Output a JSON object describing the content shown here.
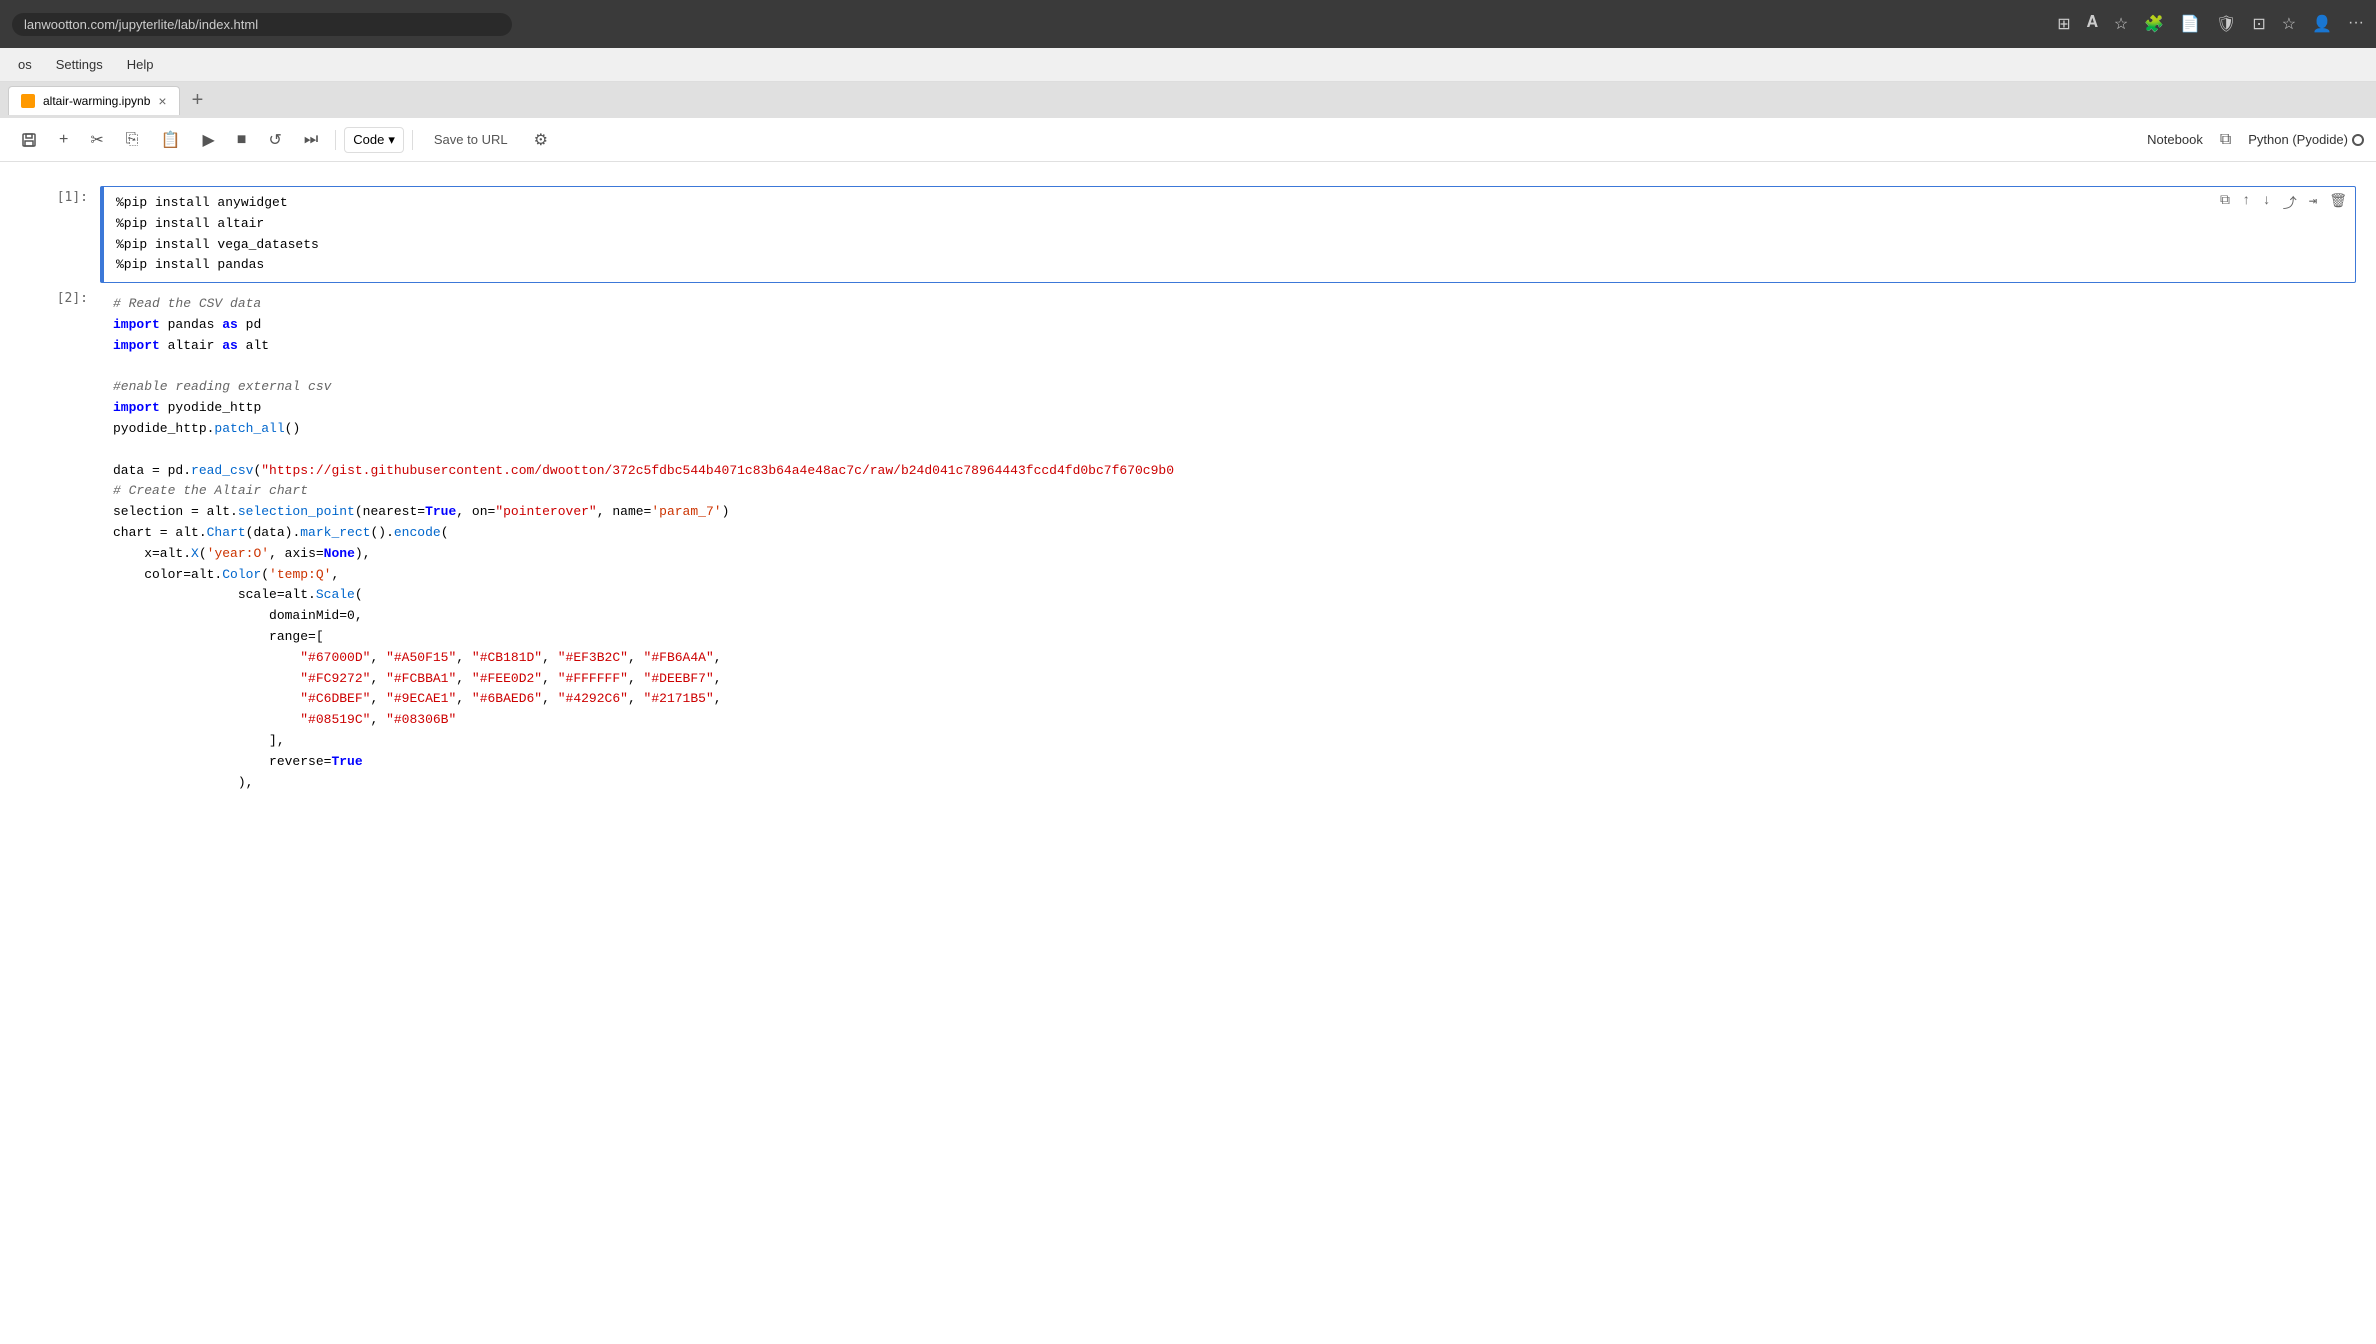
{
  "browser": {
    "url": "lanwootton.com/jupyterlite/lab/index.html"
  },
  "menu": {
    "items": [
      "os",
      "Settings",
      "Help"
    ]
  },
  "tab": {
    "icon_color": "#f90",
    "label": "altair-warming.ipynb",
    "close_symbol": "×"
  },
  "toolbar": {
    "save_icon": "💾",
    "add_icon": "+",
    "cut_icon": "✂",
    "copy_icon": "⎘",
    "paste_icon": "📋",
    "run_icon": "▶",
    "stop_icon": "■",
    "restart_icon": "↺",
    "fast_forward_icon": "⏭",
    "kernel_label": "Code",
    "save_url_label": "Save to URL",
    "settings_icon": "⚙",
    "notebook_label": "Notebook",
    "open_icon": "⧉",
    "kernel_name": "Python (Pyodide)"
  },
  "cell1": {
    "number": "[1]:",
    "lines": [
      "%pip install anywidget",
      "%pip install altair",
      "%pip install vega_datasets",
      "%pip install pandas"
    ]
  },
  "cell2": {
    "number": "[2]:",
    "lines": [
      "# Read the CSV data",
      "import pandas as pd",
      "import altair as alt",
      "",
      "#enable reading external csv",
      "import pyodide_http",
      "pyodide_http.patch_all()",
      "",
      "data = pd.read_csv(\"https://gist.githubusercontent.com/dwootton/372c5fdbc544b4071c83b64a4e48ac7c/raw/b24d041c78964443fccd4fd0bc7f670c9b0",
      "# Create the Altair chart",
      "selection = alt.selection_point(nearest=True, on=\"pointerover\", name='param_7')",
      "chart = alt.Chart(data).mark_rect().encode(",
      "    x=alt.X('year:O', axis=None),",
      "    color=alt.Color('temp:Q',",
      "                scale=alt.Scale(",
      "                    domainMid=0,",
      "                    range=[",
      "                        \"#67000D\", \"#A50F15\", \"#CB181D\", \"#EF3B2C\", \"#FB6A4A\",",
      "                        \"#FC9272\", \"#FCBBA1\", \"#FEE0D2\", \"#FFFFFF\", \"#DEEBF7\",",
      "                        \"#C6DBEF\", \"#9ECAE1\", \"#6BAED6\", \"#4292C6\", \"#2171B5\",",
      "                        \"#08519C\", \"#08306B\"",
      "                    ],",
      "                    reverse=True",
      "                ),"
    ]
  }
}
